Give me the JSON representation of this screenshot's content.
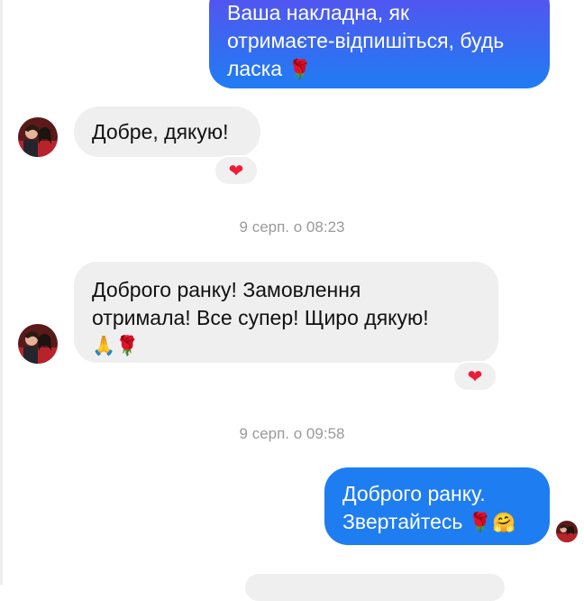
{
  "messages": [
    {
      "direction": "outgoing",
      "lines": [
        "Ваша накладна, як",
        "отримаєте-відпишіться, будь",
        "ласка"
      ],
      "emoji": "🌹"
    },
    {
      "direction": "incoming",
      "lines": [
        "Добре, дякую!"
      ],
      "reaction": "❤"
    },
    {
      "timestamp": "9 серп. о 08:23"
    },
    {
      "direction": "incoming",
      "lines": [
        "Доброго ранку! Замовлення",
        "отримала! Все супер! Щиро дякую!"
      ],
      "emoji": "🙏🌹",
      "reaction": "❤"
    },
    {
      "timestamp": "9 серп. о 09:58"
    },
    {
      "direction": "outgoing",
      "lines": [
        "Доброго ранку.",
        "Звертайтесь"
      ],
      "emoji": "🌹🤗"
    }
  ],
  "colors": {
    "outgoing_top": "#5b4ef0",
    "outgoing_bottom": "#1f7df2",
    "incoming": "#efefef",
    "reaction_heart": "#ed1d3a",
    "timestamp_text": "#9a9a9a"
  }
}
